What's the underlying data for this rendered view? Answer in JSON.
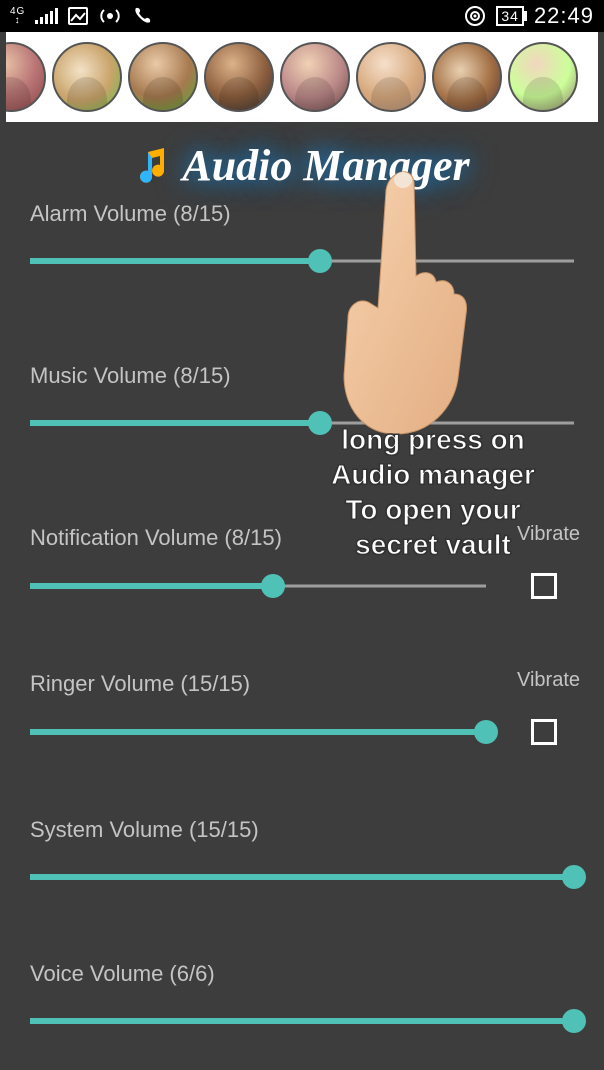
{
  "status": {
    "network": "4G",
    "battery": "34",
    "time": "22:49"
  },
  "app": {
    "title": "Audio Manager"
  },
  "avatars": [
    {
      "name": "avatar-1"
    },
    {
      "name": "avatar-2"
    },
    {
      "name": "avatar-3"
    },
    {
      "name": "avatar-4"
    },
    {
      "name": "avatar-5"
    },
    {
      "name": "avatar-6"
    },
    {
      "name": "avatar-7"
    },
    {
      "name": "avatar-8"
    }
  ],
  "sliders": {
    "alarm": {
      "label": "Alarm Volume (8/15)",
      "value": 8,
      "max": 15,
      "vibrate": null
    },
    "music": {
      "label": "Music Volume (8/15)",
      "value": 8,
      "max": 15,
      "vibrate": null
    },
    "notification": {
      "label": "Notification Volume (8/15)",
      "value": 8,
      "max": 15,
      "vibrate": false,
      "vibrate_label": "Vibrate"
    },
    "ringer": {
      "label": "Ringer Volume (15/15)",
      "value": 15,
      "max": 15,
      "vibrate": false,
      "vibrate_label": "Vibrate"
    },
    "system": {
      "label": "System Volume (15/15)",
      "value": 15,
      "max": 15,
      "vibrate": null
    },
    "voice": {
      "label": "Voice Volume (6/6)",
      "value": 6,
      "max": 6,
      "vibrate": null
    }
  },
  "hint": {
    "line1": "long press on",
    "line2": "Audio manager",
    "line3": "To open your",
    "line4": "secret vault"
  },
  "colors": {
    "accent": "#4fc1b6",
    "bg": "#3d3d3d",
    "label": "#c4c4c4"
  }
}
